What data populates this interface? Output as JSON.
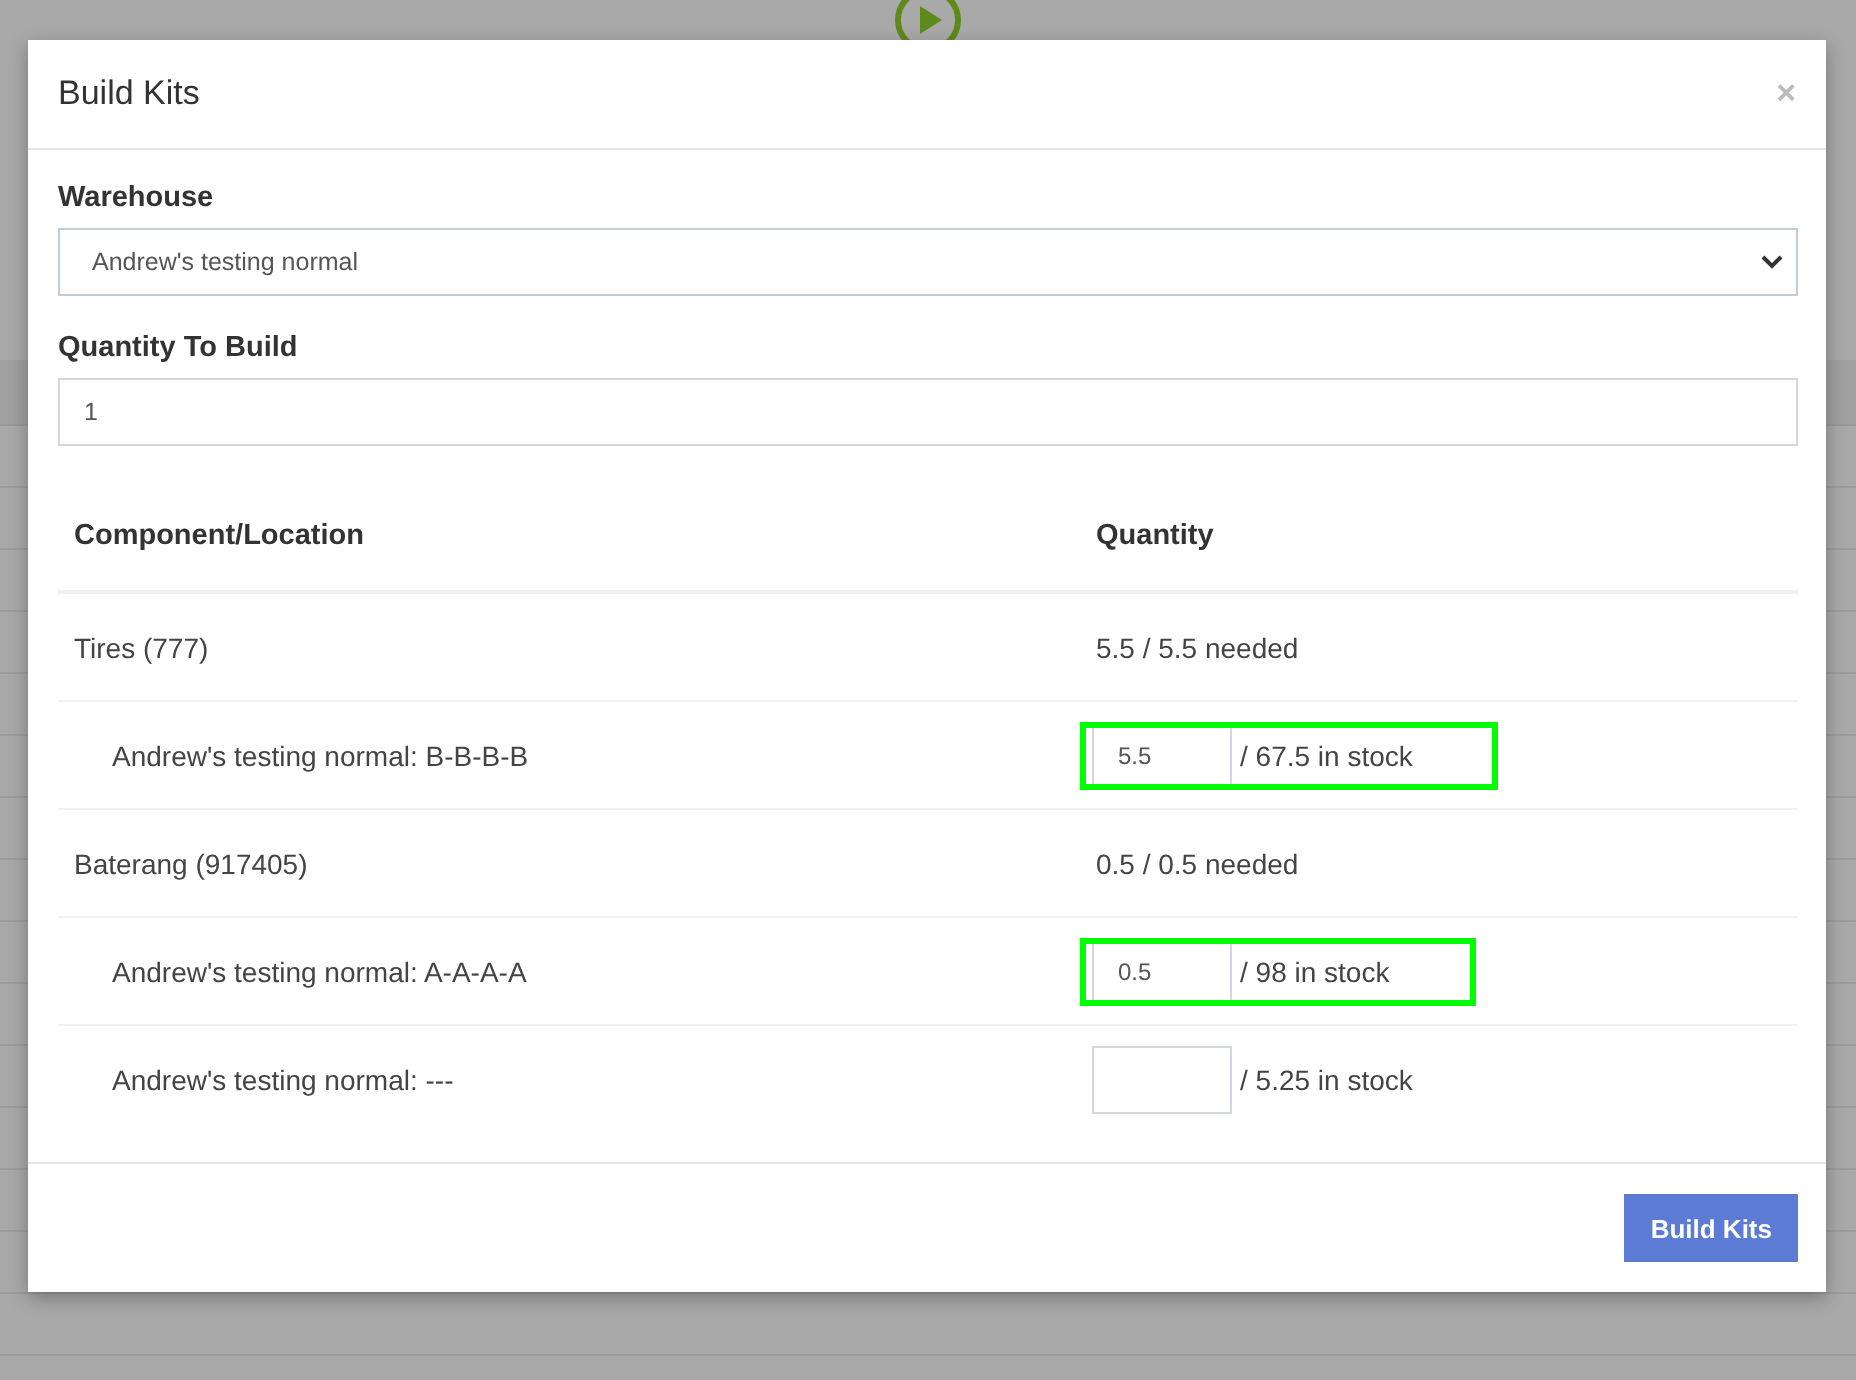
{
  "window": {
    "title": "Build Kits",
    "close": "×"
  },
  "warehouse": {
    "label": "Warehouse",
    "value": "Andrew's testing normal"
  },
  "quantity": {
    "label": "Quantity To Build",
    "value": "1"
  },
  "table": {
    "columns": [
      "Component/Location",
      "Quantity"
    ],
    "rows": [
      {
        "kind": "component",
        "name": "Tires (777)",
        "quantity": "5.5 / 5.5 needed"
      },
      {
        "kind": "location",
        "name": "Andrew's testing normal: B-B-B-B",
        "value": "5.5",
        "stock": "/ 67.5 in stock",
        "highlighted": true
      },
      {
        "kind": "component",
        "name": "Baterang (917405)",
        "quantity": "0.5 / 0.5 needed"
      },
      {
        "kind": "location",
        "name": "Andrew's testing normal: A-A-A-A",
        "value": "0.5",
        "stock": "/ 98 in stock",
        "highlighted": true
      },
      {
        "kind": "location",
        "name": "Andrew's testing normal: ---",
        "value": "",
        "stock": "/ 5.25 in stock",
        "highlighted": false
      }
    ]
  },
  "buttons": [
    {
      "label": "Build Kits"
    }
  ]
}
